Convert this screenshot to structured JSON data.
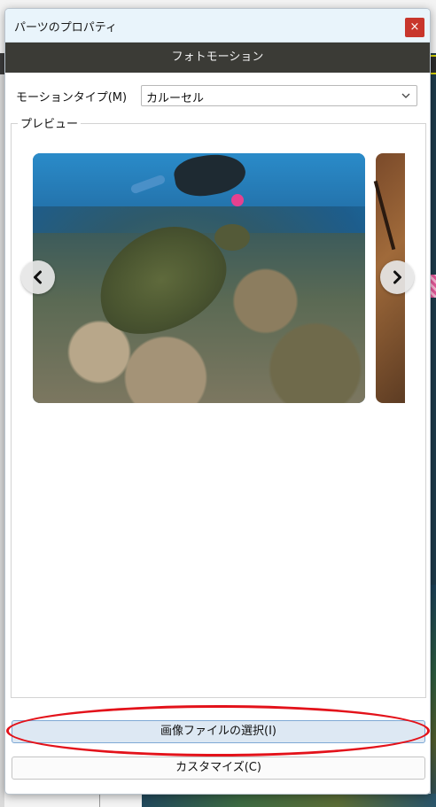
{
  "dialog": {
    "title": "パーツのプロパティ",
    "close_glyph": "×",
    "header": "フォトモーション"
  },
  "motion": {
    "label": "モーションタイプ(M)",
    "value": "カルーセル"
  },
  "preview": {
    "legend": "プレビュー"
  },
  "buttons": {
    "select_images": "画像ファイルの選択(I)",
    "customize": "カスタマイズ(C)"
  },
  "colors": {
    "header_band": "#3b3b36",
    "close_button": "#c8362c",
    "highlight_ellipse": "#e3121a",
    "primary_button_bg": "#dde8f3"
  }
}
